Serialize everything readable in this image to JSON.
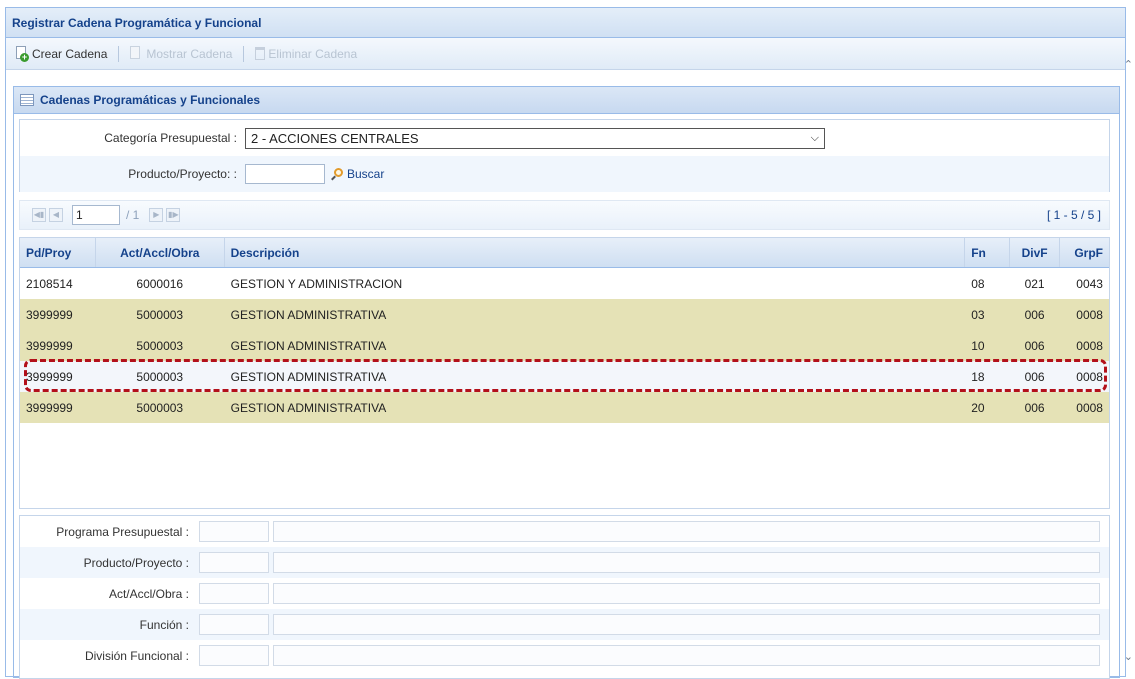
{
  "window": {
    "title": "Registrar Cadena Programática y Funcional"
  },
  "toolbar": {
    "create_label": "Crear Cadena",
    "show_label": "Mostrar Cadena",
    "delete_label": "Eliminar Cadena"
  },
  "panel": {
    "title": "Cadenas Programáticas y Funcionales"
  },
  "filter": {
    "category_label": "Categoría Presupuestal :",
    "category_value": "2 - ACCIONES CENTRALES",
    "product_label": "Producto/Proyecto: :",
    "product_value": "",
    "search_label": "Buscar"
  },
  "pager": {
    "current_page": "1",
    "total_pages": "/ 1",
    "range": "[ 1 - 5 / 5 ]"
  },
  "grid": {
    "headers": {
      "pd": "Pd/Proy",
      "act": "Act/Accl/Obra",
      "desc": "Descripción",
      "fn": "Fn",
      "divf": "DivF",
      "grpf": "GrpF"
    },
    "rows": [
      {
        "pd": "2108514",
        "act": "6000016",
        "desc": "GESTION Y ADMINISTRACION",
        "fn": "08",
        "divf": "021",
        "grpf": "0043"
      },
      {
        "pd": "3999999",
        "act": "5000003",
        "desc": "GESTION ADMINISTRATIVA",
        "fn": "03",
        "divf": "006",
        "grpf": "0008"
      },
      {
        "pd": "3999999",
        "act": "5000003",
        "desc": "GESTION ADMINISTRATIVA",
        "fn": "10",
        "divf": "006",
        "grpf": "0008"
      },
      {
        "pd": "3999999",
        "act": "5000003",
        "desc": "GESTION ADMINISTRATIVA",
        "fn": "18",
        "divf": "006",
        "grpf": "0008"
      },
      {
        "pd": "3999999",
        "act": "5000003",
        "desc": "GESTION ADMINISTRATIVA",
        "fn": "20",
        "divf": "006",
        "grpf": "0008"
      }
    ]
  },
  "form": {
    "programa_label": "Programa Presupuestal :",
    "producto_label": "Producto/Proyecto :",
    "act_label": "Act/Accl/Obra :",
    "funcion_label": "Función :",
    "division_label": "División Funcional :"
  },
  "colors": {
    "header_text": "#15428b",
    "highlight_row": "#e5e2b6",
    "selection_outline": "#b3101a",
    "border": "#99bbe8"
  }
}
